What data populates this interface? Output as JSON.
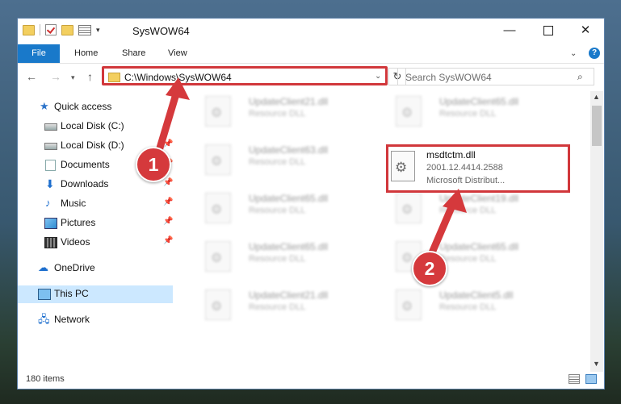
{
  "window": {
    "title": "SysWOW64"
  },
  "titlebar": {
    "minimize": "—",
    "close": "✕"
  },
  "ribbon": {
    "file": "File",
    "home": "Home",
    "share": "Share",
    "view": "View",
    "help": "?"
  },
  "address": {
    "path": "C:\\Windows\\SysWOW64"
  },
  "search": {
    "placeholder": "Search SysWOW64"
  },
  "sidebar": {
    "items": [
      {
        "label": "Quick access",
        "icon": "star-icon"
      },
      {
        "label": "Local Disk (C:)",
        "icon": "disk-icon"
      },
      {
        "label": "Local Disk (D:)",
        "icon": "disk-icon"
      },
      {
        "label": "Documents",
        "icon": "documents-icon"
      },
      {
        "label": "Downloads",
        "icon": "downloads-icon"
      },
      {
        "label": "Music",
        "icon": "music-icon"
      },
      {
        "label": "Pictures",
        "icon": "pictures-icon"
      },
      {
        "label": "Videos",
        "icon": "videos-icon"
      },
      {
        "label": "OneDrive",
        "icon": "onedrive-icon"
      },
      {
        "label": "This PC",
        "icon": "pc-icon"
      },
      {
        "label": "Network",
        "icon": "network-icon"
      }
    ]
  },
  "files": [
    {
      "name": "UpdateClient21.dll",
      "type": "Resource DLL"
    },
    {
      "name": "UpdateClient65.dll",
      "type": "Resource DLL"
    },
    {
      "name": "UpdateClient63.dll",
      "type": "Resource DLL"
    },
    {
      "name": "UpdateClient65.dll",
      "type": "Resource DLL"
    },
    {
      "name": "UpdateClient19.dll",
      "type": "Resource DLL"
    },
    {
      "name": "UpdateClient65.dll",
      "type": "Resource DLL"
    },
    {
      "name": "UpdateClient65.dll",
      "type": "Resource DLL"
    },
    {
      "name": "UpdateClient21.dll",
      "type": "Resource DLL"
    },
    {
      "name": "UpdateClient5.dll",
      "type": "Resource DLL"
    }
  ],
  "featured_file": {
    "name": "msdtctm.dll",
    "version": "2001.12.4414.2588",
    "company": "Microsoft Distribut..."
  },
  "callouts": {
    "one": "1",
    "two": "2"
  },
  "status": {
    "item_count": "180 items"
  },
  "colors": {
    "accent": "#1979ca",
    "highlight": "#d1373b",
    "selection": "#cce8ff"
  }
}
